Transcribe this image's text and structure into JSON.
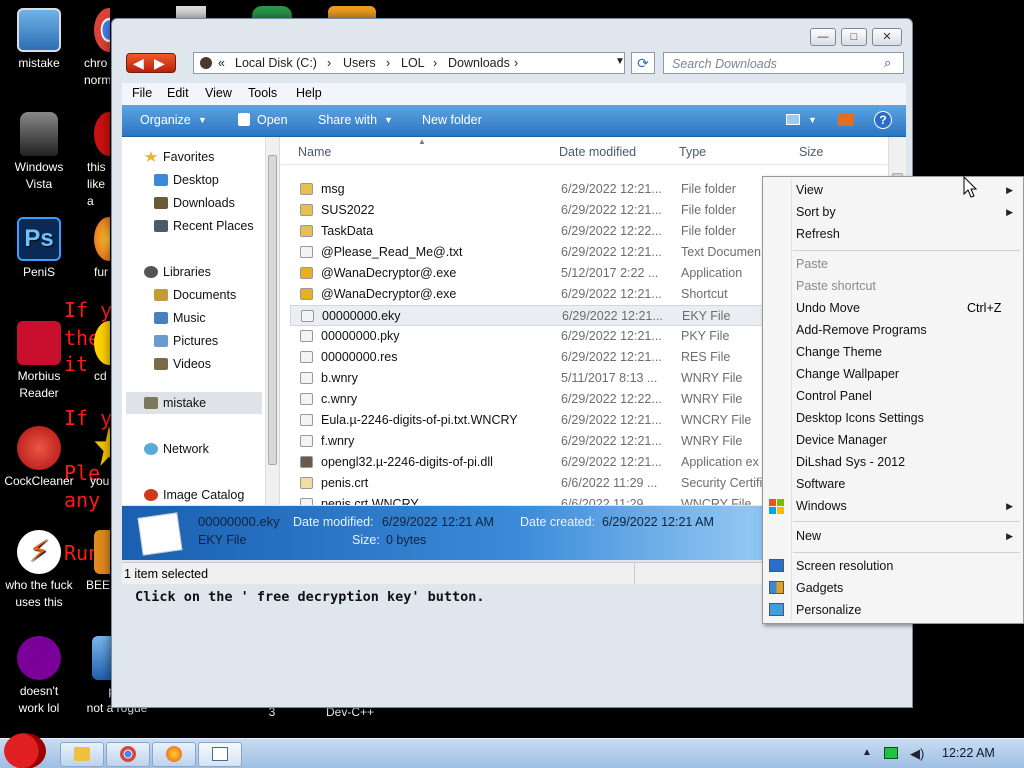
{
  "desktop": {
    "icons": [
      {
        "label": "mistake"
      },
      {
        "label": "chro\nnorm"
      },
      {
        "label": "Windows\nVista"
      },
      {
        "label": "this\nlike a"
      },
      {
        "label": "PeniS"
      },
      {
        "label": "fur"
      },
      {
        "label": "Morbius\nReader"
      },
      {
        "label": "cd"
      },
      {
        "label": "CockCleaner"
      },
      {
        "label": "you"
      },
      {
        "label": "who the fuck\nuses this"
      },
      {
        "label": "BEE"
      },
      {
        "label": "doesn't\nwork lol"
      },
      {
        "label": "pro\nnot a rogue"
      },
      {
        "label": "3"
      },
      {
        "label": "Dev-C++"
      }
    ],
    "red_text": [
      "If y",
      "the",
      "it",
      "If y",
      "Ple",
      "any",
      "Run"
    ]
  },
  "explorer": {
    "window_buttons": {
      "minimize": "—",
      "maximize": "□",
      "close": "✕"
    },
    "address": {
      "prefix": "«",
      "crumbs": [
        "Local Disk (C:)",
        "Users",
        "LOL",
        "Downloads"
      ],
      "separator": "›"
    },
    "search_placeholder": "Search Downloads",
    "menu": [
      "File",
      "Edit",
      "View",
      "Tools",
      "Help"
    ],
    "toolbar": {
      "organize": "Organize",
      "open": "Open",
      "share_with": "Share with",
      "new_folder": "New folder"
    },
    "nav": {
      "favorites": "Favorites",
      "desktop": "Desktop",
      "downloads": "Downloads",
      "recent_places": "Recent Places",
      "libraries": "Libraries",
      "documents": "Documents",
      "music": "Music",
      "pictures": "Pictures",
      "videos": "Videos",
      "mistake": "mistake",
      "network": "Network",
      "image_catalog": "Image Catalog"
    },
    "columns": {
      "name": "Name",
      "date_modified": "Date modified",
      "type": "Type",
      "size": "Size"
    },
    "files": [
      {
        "name": "msg",
        "date": "6/29/2022 12:21...",
        "type": "File folder",
        "icon": "folder-icon"
      },
      {
        "name": "SUS2022",
        "date": "6/29/2022 12:21...",
        "type": "File folder",
        "icon": "folder-icon"
      },
      {
        "name": "TaskData",
        "date": "6/29/2022 12:22...",
        "type": "File folder",
        "icon": "folder-icon"
      },
      {
        "name": "@Please_Read_Me@.txt",
        "date": "6/29/2022 12:21...",
        "type": "Text Documen",
        "icon": "text-file-icon"
      },
      {
        "name": "@WanaDecryptor@.exe",
        "date": "5/12/2017 2:22 ...",
        "type": "Application",
        "icon": "app-icon"
      },
      {
        "name": "@WanaDecryptor@.exe",
        "date": "6/29/2022 12:21...",
        "type": "Shortcut",
        "icon": "app-icon"
      },
      {
        "name": "00000000.eky",
        "date": "6/29/2022 12:21...",
        "type": "EKY File",
        "icon": "file-icon"
      },
      {
        "name": "00000000.pky",
        "date": "6/29/2022 12:21...",
        "type": "PKY File",
        "icon": "file-icon"
      },
      {
        "name": "00000000.res",
        "date": "6/29/2022 12:21...",
        "type": "RES File",
        "icon": "file-icon"
      },
      {
        "name": "b.wnry",
        "date": "5/11/2017 8:13 ...",
        "type": "WNRY File",
        "icon": "file-icon"
      },
      {
        "name": "c.wnry",
        "date": "6/29/2022 12:22...",
        "type": "WNRY File",
        "icon": "file-icon"
      },
      {
        "name": "Eula.µ-2246-digits-of-pi.txt.WNCRY",
        "date": "6/29/2022 12:21...",
        "type": "WNCRY File",
        "icon": "file-icon"
      },
      {
        "name": "f.wnry",
        "date": "6/29/2022 12:21...",
        "type": "WNRY File",
        "icon": "file-icon"
      },
      {
        "name": "opengl32.µ-2246-digits-of-pi.dll",
        "date": "6/29/2022 12:21...",
        "type": "Application ex",
        "icon": "dll-icon"
      },
      {
        "name": "penis.crt",
        "date": "6/6/2022 11:29 ...",
        "type": "Security Certifi",
        "icon": "certificate-icon"
      },
      {
        "name": "penis.crt.WNCRY",
        "date": "6/6/2022 11:29 ...",
        "type": "WNCRY File",
        "icon": "file-icon"
      }
    ],
    "selected_index": 6,
    "details": {
      "filename": "00000000.eky",
      "filetype": "EKY File",
      "date_modified_label": "Date modified:",
      "date_modified": "6/29/2022 12:21 AM",
      "date_created_label": "Date created:",
      "date_created": "6/29/2022 12:21 AM",
      "size_label": "Size:",
      "size": "0 bytes"
    },
    "status": "1 item selected"
  },
  "behind_window_text": "Click on the ' free decryption key' button.",
  "context_menu": {
    "items": [
      {
        "label": "View",
        "submenu": true
      },
      {
        "label": "Sort by",
        "submenu": true
      },
      {
        "label": "Refresh"
      },
      {
        "label": "Paste",
        "disabled": true
      },
      {
        "label": "Paste shortcut",
        "disabled": true
      },
      {
        "label": "Undo Move",
        "shortcut": "Ctrl+Z"
      },
      {
        "label": "Add-Remove Programs"
      },
      {
        "label": "Change Theme"
      },
      {
        "label": "Change Wallpaper"
      },
      {
        "label": "Control Panel"
      },
      {
        "label": "Desktop Icons Settings"
      },
      {
        "label": "Device Manager"
      },
      {
        "label": "DiLshad Sys - 2012"
      },
      {
        "label": "Software"
      },
      {
        "label": "Windows",
        "submenu": true
      },
      {
        "label": "New",
        "submenu": true
      },
      {
        "label": "Screen resolution"
      },
      {
        "label": "Gadgets"
      },
      {
        "label": "Personalize"
      }
    ]
  },
  "taskbar": {
    "time": "12:22 AM"
  }
}
